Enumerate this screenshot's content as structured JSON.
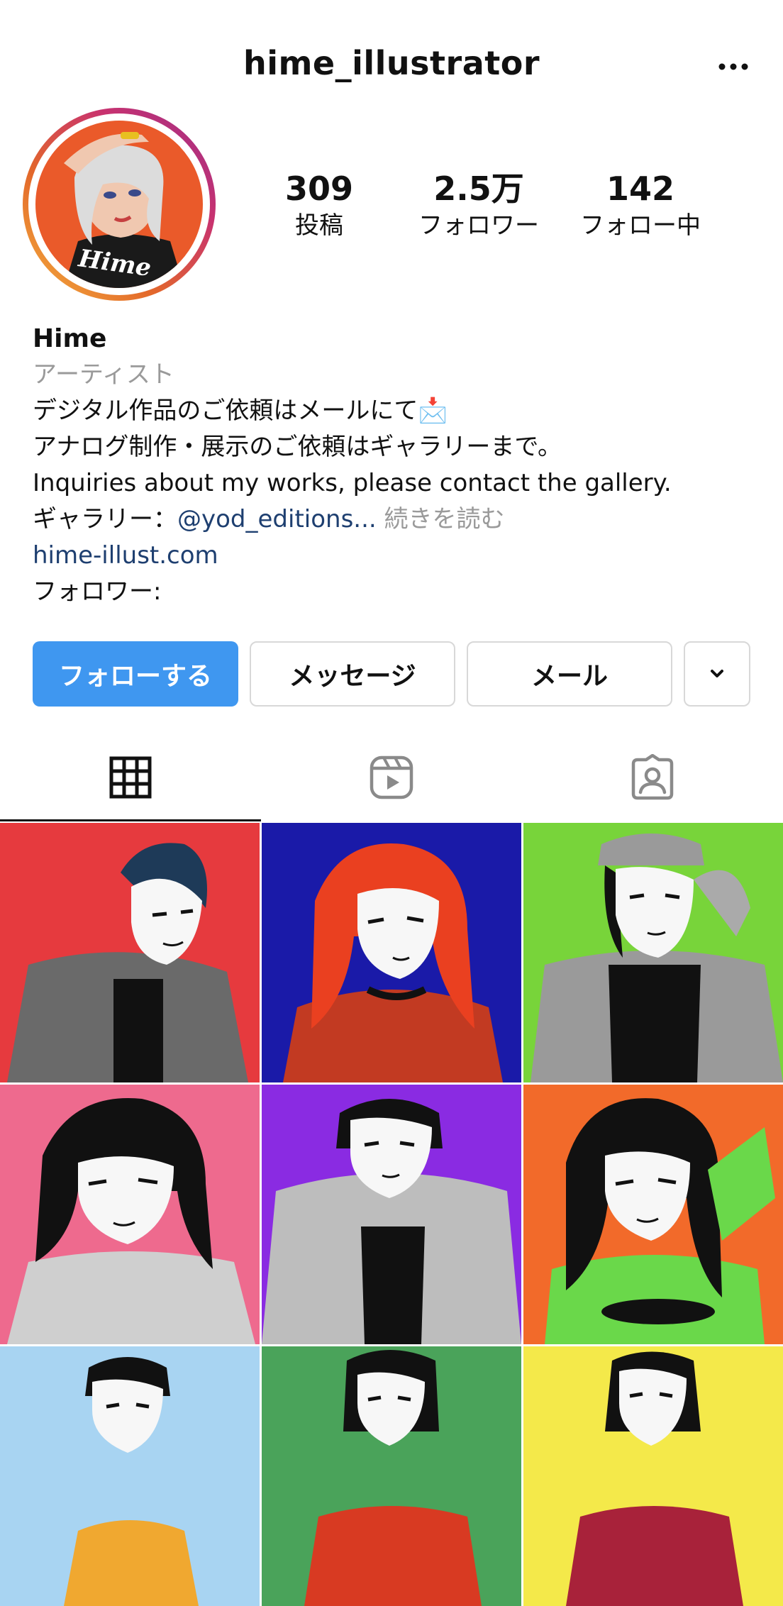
{
  "header": {
    "username": "hime_illustrator",
    "more_icon": "more-horizontal-icon"
  },
  "stats": [
    {
      "value": "309",
      "label": "投稿"
    },
    {
      "value": "2.5万",
      "label": "フォロワー"
    },
    {
      "value": "142",
      "label": "フォロー中"
    }
  ],
  "bio": {
    "name": "Hime",
    "category": "アーティスト",
    "line1": "デジタル作品のご依頼はメールにて📩",
    "line2": "アナログ制作・展示のご依頼はギャラリーまで。",
    "line3": "Inquiries about my works, please contact the gallery.",
    "gallery_label": "ギャラリー：",
    "gallery_handle": "@yod_editions...",
    "read_more": "続きを読む",
    "website": "hime-illust.com",
    "followers_label": "フォロワー:"
  },
  "buttons": {
    "follow": "フォローする",
    "message": "メッセージ",
    "mail": "メール",
    "dropdown_icon": "chevron-down-icon"
  },
  "tabs": [
    {
      "icon": "grid-icon",
      "active": true
    },
    {
      "icon": "reels-icon",
      "active": false
    },
    {
      "icon": "tagged-icon",
      "active": false
    }
  ],
  "colors": {
    "accent": "#3f97f0",
    "link": "#1e3f70",
    "muted": "#9a9a9a",
    "tiles": [
      "#e63a3e",
      "#1a1aa8",
      "#78d43a",
      "#ee6a8e",
      "#8a2be2",
      "#f26a2a",
      "#a8d4f2",
      "#4aa35a",
      "#f4e94a"
    ]
  }
}
